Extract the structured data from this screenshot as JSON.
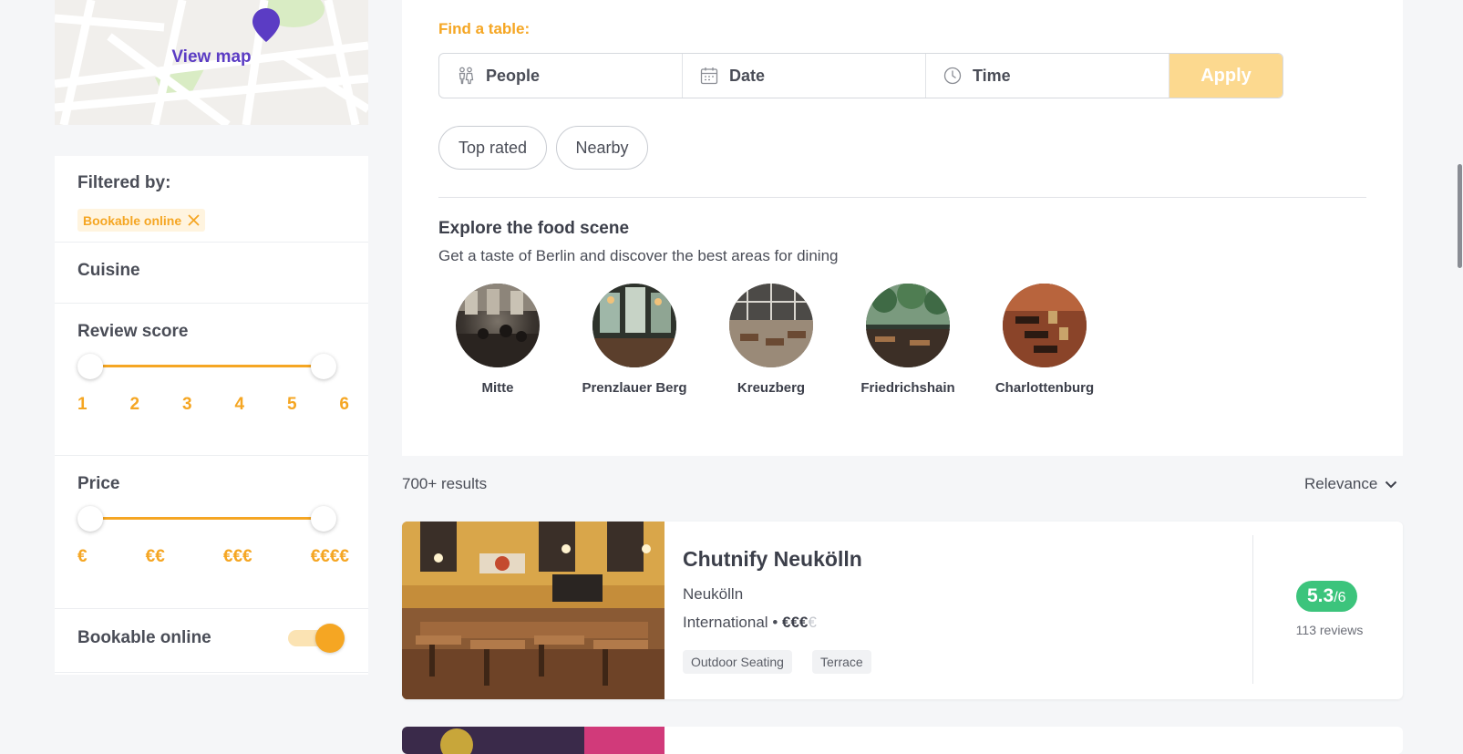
{
  "map": {
    "view_map_label": "View map"
  },
  "filters": {
    "filtered_by_label": "Filtered by:",
    "active_filters": [
      "Bookable online"
    ],
    "cuisine_label": "Cuisine",
    "review_score": {
      "label": "Review score",
      "scale": [
        "1",
        "2",
        "3",
        "4",
        "5",
        "6"
      ],
      "selected_min": 1,
      "selected_max": 6
    },
    "price": {
      "label": "Price",
      "scale": [
        "€",
        "€€",
        "€€€",
        "€€€€"
      ],
      "selected_min": 1,
      "selected_max": 4
    },
    "bookable_online": {
      "label": "Bookable online",
      "enabled": true
    }
  },
  "search": {
    "title": "Find a table:",
    "people_placeholder": "People",
    "date_placeholder": "Date",
    "time_placeholder": "Time",
    "apply_label": "Apply"
  },
  "quick_filters": [
    "Top rated",
    "Nearby"
  ],
  "explore": {
    "title": "Explore the food scene",
    "subtitle": "Get a taste of Berlin and discover the best areas for dining",
    "areas": [
      "Mitte",
      "Prenzlauer Berg",
      "Kreuzberg",
      "Friedrichshain",
      "Charlottenburg"
    ]
  },
  "results": {
    "count_label": "700+ results",
    "sort_label": "Relevance",
    "items": [
      {
        "name": "Chutnify Neukölln",
        "area": "Neukölln",
        "cuisine": "International",
        "price_active": "€€€",
        "price_inactive": "€",
        "tags": [
          "Outdoor Seating",
          "Terrace"
        ],
        "score": "5.3",
        "score_max": "/6",
        "reviews": "113 reviews"
      }
    ]
  },
  "colors": {
    "accent": "#f5a623",
    "brand_purple": "#5b3cc4",
    "score_green": "#3cc47c",
    "apply_disabled": "#fcd98f"
  }
}
